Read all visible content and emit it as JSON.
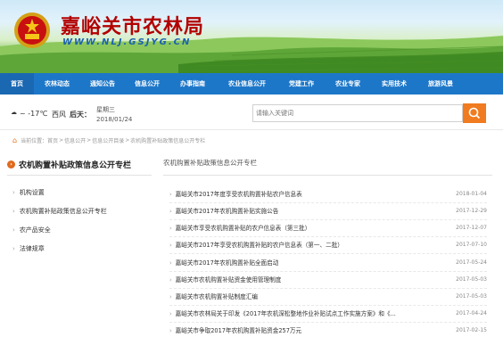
{
  "header": {
    "site_title": "嘉峪关市农林局",
    "site_url": "WWW.NLJ.GSJYG.CN"
  },
  "nav": {
    "items": [
      "首页",
      "农林动态",
      "通知公告",
      "信息公开",
      "办事指南",
      "农业信息公开",
      "党建工作",
      "农业专家",
      "实用技术",
      "旅游风景"
    ]
  },
  "weather": {
    "temp": "~ -17℃",
    "wind": "西风",
    "day": "后天：",
    "week": "星期三",
    "date": "2018/01/24"
  },
  "search": {
    "placeholder": "请输入关键词"
  },
  "breadcrumb": {
    "prefix": "当前位置：",
    "items": [
      "首页",
      "信息公开",
      "信息公开目录",
      "农机购置补贴政策信息公开专栏"
    ]
  },
  "left": {
    "title": "农机购置补贴政策信息公开专栏",
    "items": [
      "机构设置",
      "农机购置补贴政策信息公开专栏",
      "农产品安全",
      "法律规章"
    ]
  },
  "right": {
    "tab": "农机购置补贴政策信息公开专栏",
    "news": [
      {
        "title": "嘉峪关市2017年度享受农机购置补贴农户信息表",
        "date": "2018-01-04"
      },
      {
        "title": "嘉峪关市2017年农机购置补贴实施公告",
        "date": "2017-12-29"
      },
      {
        "title": "嘉峪关市享受农机购置补贴的农户信息表（第三批）",
        "date": "2017-12-07"
      },
      {
        "title": "嘉峪关市2017年享受农机购置补贴的农户信息表（第一、二批）",
        "date": "2017-07-10"
      },
      {
        "title": "嘉峪关市2017年农机购置补贴全面启动",
        "date": "2017-05-24"
      },
      {
        "title": "嘉峪关市农机购置补贴资金使用管理制度",
        "date": "2017-05-03"
      },
      {
        "title": "嘉峪关市农机购置补贴制度汇编",
        "date": "2017-05-03"
      },
      {
        "title": "嘉峪关市农林局关于印发《2017年农机深松整地作业补贴试点工作实施方案》和《...",
        "date": "2017-04-24"
      },
      {
        "title": "嘉峪关市争取2017年农机购置补贴资金257万元",
        "date": "2017-02-15"
      }
    ]
  },
  "colors": {
    "nav_bg": "#1d77c9",
    "title_red": "#b30000",
    "url_blue": "#1b61b1",
    "accent_orange": "#f07b20"
  }
}
